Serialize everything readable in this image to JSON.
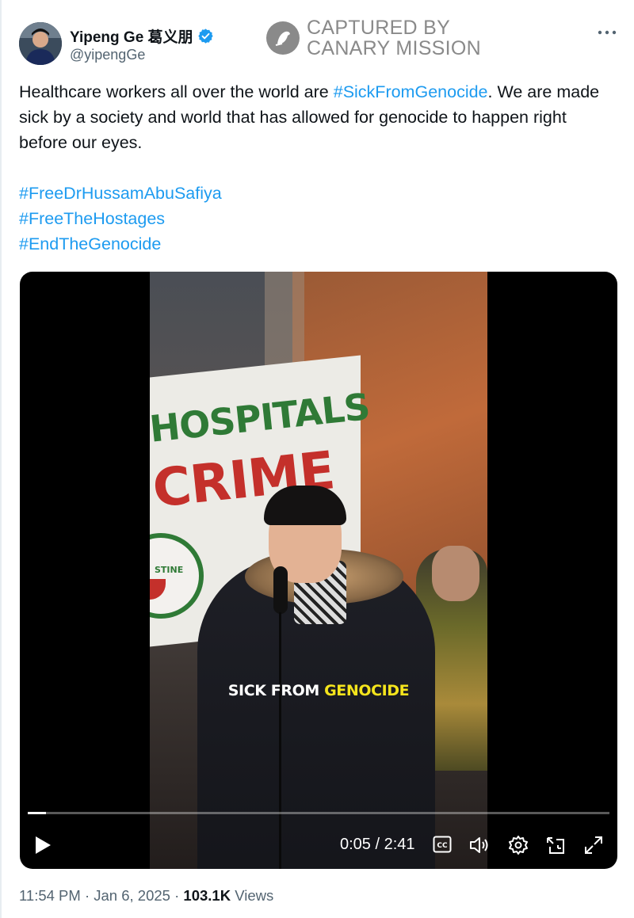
{
  "author": {
    "display_name": "Yipeng Ge 葛义朋",
    "handle": "@yipengGe",
    "verified": true,
    "avatar_icon": "user-avatar"
  },
  "watermark": {
    "line1": "CAPTURED BY",
    "line2": "CANARY MISSION"
  },
  "tweet": {
    "text_before": "Healthcare workers all over the world are ",
    "hashtag_inline": "#SickFromGenocide",
    "text_after": ". We are made sick by a society and world that has allowed for genocide to happen right before our eyes.",
    "hashtags": [
      "#FreeDrHussamAbuSafiya",
      "#FreeTheHostages",
      "#EndTheGenocide"
    ]
  },
  "video": {
    "banner_line1": "HOSPITALS",
    "banner_line2": "CRIME",
    "badge_text": "STINE",
    "caption_white": "SICK FROM ",
    "caption_yellow": "GENOCIDE",
    "time_display": "0:05 / 2:41",
    "progress_fraction": 0.031,
    "control_icons": [
      "play-icon",
      "captions-icon",
      "volume-icon",
      "settings-icon",
      "pip-icon",
      "fullscreen-icon"
    ]
  },
  "meta": {
    "time": "11:54 PM",
    "sep1": " · ",
    "date": "Jan 6, 2025",
    "sep2": " · ",
    "views_count": "103.1K",
    "views_label": " Views"
  },
  "colors": {
    "link": "#1d9bf0",
    "verified": "#1d9bf0",
    "secondary_text": "#536471",
    "caption_highlight": "#f4e41c"
  }
}
